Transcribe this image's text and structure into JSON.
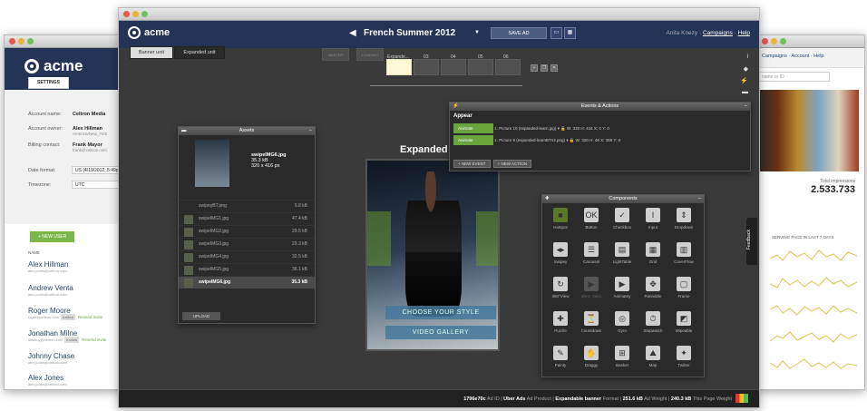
{
  "left_window": {
    "logo": "acme",
    "tab": "SETTINGS",
    "fields": [
      {
        "label": "Account name:",
        "value": "Celtron Media"
      },
      {
        "label": "Account owner:",
        "value": "Alex Hillman",
        "sub": "America/New_York"
      },
      {
        "label": "Billing contact:",
        "value": "Frank Mayor",
        "sub": "frank@celtron.com"
      },
      {
        "label": "Date format:",
        "value": "US (4/19/2012, 5:49p"
      },
      {
        "label": "Timezone:",
        "value": "UTC"
      }
    ],
    "new_user_button": "+ NEW USER",
    "name_header": "NAME",
    "users": [
      {
        "name": "Alex Hillman",
        "email": "alex.jones@celtron.com"
      },
      {
        "name": "Andrew Venta",
        "email": "alex.jones@celtron.com"
      },
      {
        "name": "Roger Moore",
        "email": "roger@celtron.com",
        "tag": "Invited",
        "link": "Resend invite"
      },
      {
        "name": "Jonathan Milne",
        "email": "littlebuy@celtron.com",
        "tag": "Invited",
        "link": "Resend invite"
      },
      {
        "name": "Johnny Chase",
        "email": "alex.jones@celtron.com"
      },
      {
        "name": "Alex Jones",
        "email": "alex.jones@celtron.com"
      }
    ]
  },
  "right_window": {
    "nav": "Campaigns · Account · Help",
    "search_placeholder": "name or ID",
    "impressions_label": "Total impressions",
    "impressions": "2.533.733",
    "serving_label": "SERVING PACE IN LAST 7 DAYS"
  },
  "feedback": "Feedback",
  "main": {
    "logo": "acme",
    "ad_title": "French Summer 2012",
    "save_label": "SAVE AD",
    "user": "Anita Knezy",
    "campaigns": "Campaigns",
    "help": "Help",
    "units": [
      "Banner unit",
      "Expanded unit"
    ],
    "master": "MASTER",
    "loading": "LOADING",
    "frames": [
      "Expande...",
      "03",
      "04",
      "05",
      "06"
    ],
    "assets": {
      "title": "Assets",
      "file": "swipeIMG6.jpg",
      "size": "35.3 kB",
      "dims": "320 x 416 px",
      "list": [
        {
          "name": "swipeyBT.png",
          "size": "5.8 kB"
        },
        {
          "name": "swipeIMG1.jpg",
          "size": "47.4 kB"
        },
        {
          "name": "swipeIMG2.jpg",
          "size": "29.5 kB"
        },
        {
          "name": "swipeIMG3.jpg",
          "size": "29.3 kB"
        },
        {
          "name": "swipeIMG4.jpg",
          "size": "32.5 kB"
        },
        {
          "name": "swipeIMG5.jpg",
          "size": "36.1 kB"
        },
        {
          "name": "swipeIMG6.jpg",
          "size": "35.3 kB"
        }
      ],
      "upload": "UPLOAD"
    },
    "events": {
      "title": "Events & Actions",
      "group": "Appear",
      "rows": [
        {
          "action": "Animate",
          "target": "Picture 10 (expanded-learn.jpg)",
          "w": "320",
          "h": "416",
          "x": "0",
          "y": "0"
        },
        {
          "action": "Animate",
          "target": "Picture 9 (expanded-learnBTn2.png)",
          "w": "320",
          "h": "48",
          "x": "368",
          "y": "0"
        }
      ],
      "new_event": "+ NEW EVENT",
      "new_action": "+ NEW ACTION"
    },
    "expanded_label": "Expanded -",
    "ad_buttons": [
      "CHOOSE YOUR STYLE",
      "VIDEO GALLERY"
    ],
    "components": {
      "title": "Components",
      "items": [
        "Hotspot",
        "Button",
        "Checkbox",
        "Input",
        "Dropdown",
        "Swipey",
        "Carousel",
        "LightTable",
        "Grid",
        "CoverFlow",
        "360°View",
        "Inline video",
        "Animatey",
        "Pannable",
        "Frame",
        "Puzzle",
        "Countdown",
        "Gyro",
        "Stopwatch",
        "Wipeable",
        "Painty",
        "Draggy",
        "Basket",
        "Map",
        "Twitter"
      ]
    },
    "footer": {
      "ad_id": "1796e70c",
      "ad_id_l": "Ad ID",
      "product": "Uber Ads",
      "product_l": "Ad Product",
      "format": "Expandable banner",
      "format_l": "Format",
      "weight": "251.6 kB",
      "weight_l": "Ad Weight",
      "page": "240.3 kB",
      "page_l": "This Page Weight"
    }
  }
}
